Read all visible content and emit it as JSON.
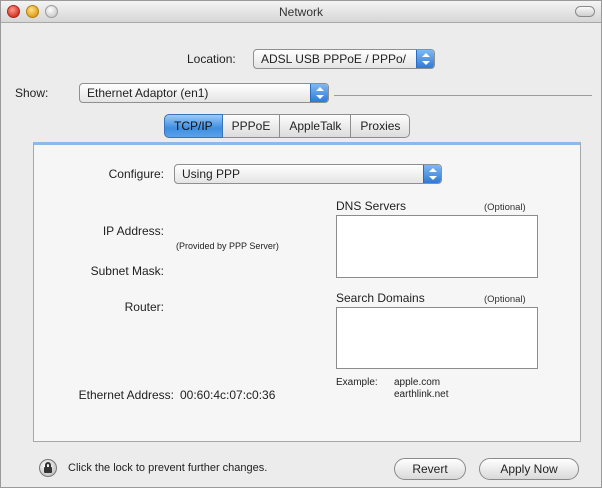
{
  "window": {
    "title": "Network"
  },
  "location": {
    "label": "Location:",
    "value": "ADSL USB PPPoE / PPPo/"
  },
  "show": {
    "label": "Show:",
    "value": "Ethernet Adaptor (en1)"
  },
  "tabs": [
    {
      "label": "TCP/IP",
      "active": true
    },
    {
      "label": "PPPoE",
      "active": false
    },
    {
      "label": "AppleTalk",
      "active": false
    },
    {
      "label": "Proxies",
      "active": false
    }
  ],
  "tcpip": {
    "configure_label": "Configure:",
    "configure_value": "Using PPP",
    "ip_address_label": "IP Address:",
    "provided_note": "(Provided by PPP Server)",
    "subnet_mask_label": "Subnet Mask:",
    "router_label": "Router:",
    "ethernet_address_label": "Ethernet Address:",
    "ethernet_address_value": "00:60:4c:07:c0:36",
    "dns_servers_label": "DNS Servers",
    "dns_optional": "(Optional)",
    "search_domains_label": "Search Domains",
    "search_optional": "(Optional)",
    "example_label": "Example:",
    "example_line1": "apple.com",
    "example_line2": "earthlink.net"
  },
  "footer": {
    "lock_text": "Click the lock to prevent further changes.",
    "revert_label": "Revert",
    "apply_label": "Apply Now"
  },
  "colors": {
    "accent": "#3e8ee0",
    "panel_top": "#8db9e6"
  }
}
